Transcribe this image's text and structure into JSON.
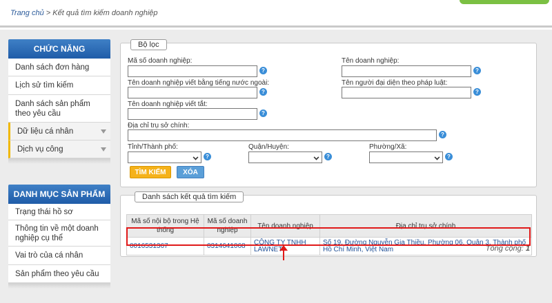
{
  "breadcrumb": {
    "home": "Trang chủ",
    "separator": " > ",
    "current": "Kết quả tìm kiếm doanh nghiệp"
  },
  "sidebar": {
    "functions_title": "CHỨC NĂNG",
    "functions": [
      {
        "label": "Danh sách đơn hàng"
      },
      {
        "label": "Lịch sử tìm kiếm"
      },
      {
        "label": "Danh sách sản phẩm theo yêu cầu"
      },
      {
        "label": "Dữ liệu cá nhân"
      },
      {
        "label": "Dịch vụ công"
      }
    ],
    "catalog_title": "DANH MỤC SẢN PHẨM",
    "catalog": [
      {
        "label": "Trạng thái hồ sơ"
      },
      {
        "label": "Thông tin về một doanh nghiệp cụ thể"
      },
      {
        "label": "Vai trò của cá nhân"
      },
      {
        "label": "Sản phẩm theo yêu cầu"
      }
    ]
  },
  "filter": {
    "legend": "Bộ lọc",
    "company_code_label": "Mã số doanh nghiệp:",
    "company_name_label": "Tên doanh nghiệp:",
    "foreign_name_label": "Tên doanh nghiệp viết bằng tiếng nước ngoài:",
    "legal_rep_label": "Tên người đại diện theo pháp luật:",
    "short_name_label": "Tên doanh nghiệp viết tắt:",
    "address_label": "Địa chỉ trụ sở chính:",
    "province_label": "Tỉnh/Thành phố:",
    "district_label": "Quận/Huyện:",
    "ward_label": "Phường/Xã:",
    "search_button": "TÌM KIẾM",
    "clear_button": "XÓA",
    "help_glyph": "?"
  },
  "results": {
    "legend": "Danh sách kết quả tìm kiếm",
    "columns": [
      "Mã số nội bộ trong Hệ thống",
      "Mã số doanh nghiệp",
      "Tên doanh nghiệp",
      "Địa chỉ trụ sở chính"
    ],
    "rows": [
      {
        "internal_id": "0016531367",
        "company_code": "0314641068",
        "company_name": "CÔNG TY TNHH LAWNET",
        "address": "Số 19, Đường Nguyễn Gia Thiều, Phường 06, Quận 3, Thành phố Hồ Chí Minh, Việt Nam"
      }
    ],
    "total_label": "Tổng cộng:",
    "total_value": "1"
  },
  "colors": {
    "accent_blue": "#1f5ca8",
    "highlight": "#e01818",
    "search_btn": "#f5b21a"
  }
}
